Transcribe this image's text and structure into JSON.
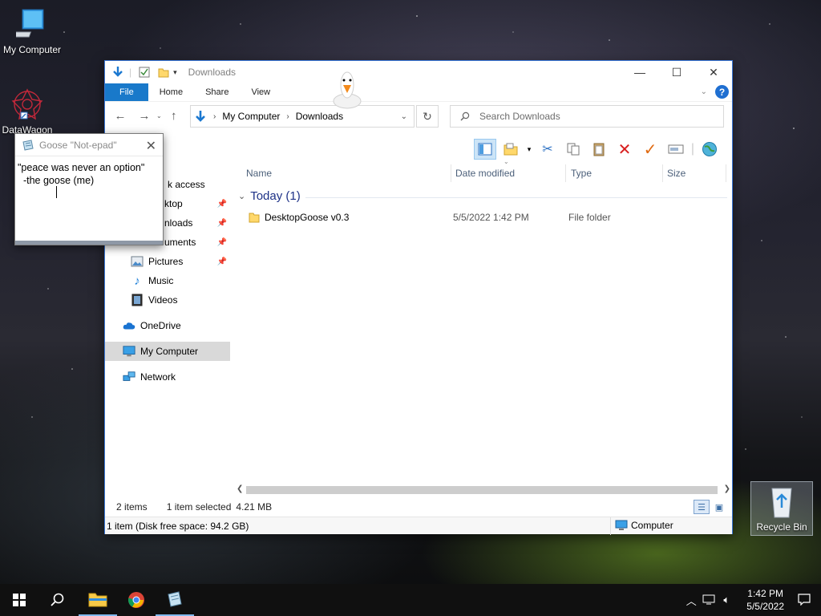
{
  "desktop": {
    "icons": [
      {
        "label": "My Computer"
      },
      {
        "label": "DataWagon"
      },
      {
        "label": "Recycle Bin"
      }
    ]
  },
  "explorer": {
    "title": "Downloads",
    "ribbon_tabs": [
      "File",
      "Home",
      "Share",
      "View"
    ],
    "help_label": "?",
    "breadcrumb": [
      "My Computer",
      "Downloads"
    ],
    "search_placeholder": "Search Downloads",
    "nav_items": [
      {
        "label": "k access"
      },
      {
        "label": "ktop"
      },
      {
        "label": "nloads"
      },
      {
        "label": "uments"
      },
      {
        "label": "Pictures"
      },
      {
        "label": "Music"
      },
      {
        "label": "Videos"
      },
      {
        "label": "OneDrive"
      },
      {
        "label": "My Computer"
      },
      {
        "label": "Network"
      }
    ],
    "columns": [
      "Name",
      "Date modified",
      "Type",
      "Size"
    ],
    "group_label": "Today (1)",
    "files": [
      {
        "name": "DesktopGoose v0.3",
        "date": "5/5/2022 1:42 PM",
        "type": "File folder",
        "size": ""
      }
    ],
    "status": {
      "items": "2 items",
      "selected": "1 item selected",
      "size": "4.21 MB"
    },
    "info": {
      "left": "1 item (Disk free space: 94.2 GB)",
      "right": "Computer"
    }
  },
  "notepad": {
    "title": "Goose \"Not-epad\"",
    "text": "\"peace was never an option\"\n  -the goose (me)"
  },
  "taskbar": {
    "time": "1:42 PM",
    "date": "5/5/2022"
  },
  "colors": {
    "accent": "#1979ca",
    "group_text": "#1e3287",
    "column_text": "#4c607a"
  }
}
